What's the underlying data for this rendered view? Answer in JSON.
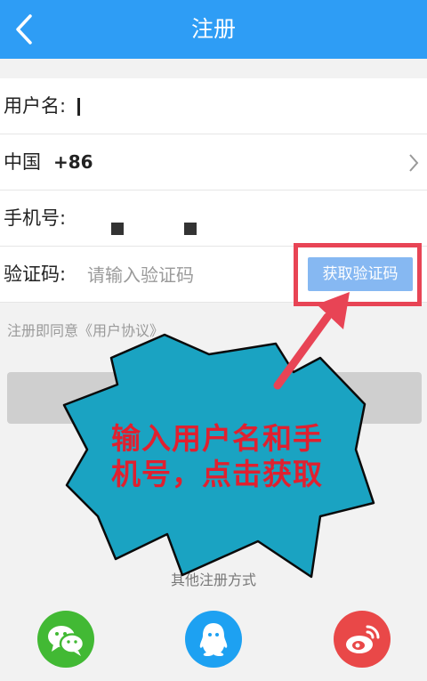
{
  "header": {
    "title": "注册"
  },
  "form": {
    "username_label": "用户名:",
    "country_label": "中国",
    "country_code": "+86",
    "phone_label": "手机号:",
    "code_label": "验证码:",
    "code_placeholder": "请输入验证码",
    "get_code_label": "获取验证码"
  },
  "agreement": "注册即同意《用户协议》",
  "other_methods_label": "其他注册方式",
  "annotation": {
    "text": "输入用户名和手机号，点击获取"
  },
  "colors": {
    "header": "#2e9df5",
    "highlight": "#e84455",
    "callout_fill": "#1aa3c2",
    "callout_text": "#e0202f"
  },
  "icons": {
    "back": "chevron-left-icon",
    "country_select": "chevron-right-icon",
    "wechat": "wechat-icon",
    "qq": "qq-icon",
    "weibo": "weibo-icon"
  }
}
